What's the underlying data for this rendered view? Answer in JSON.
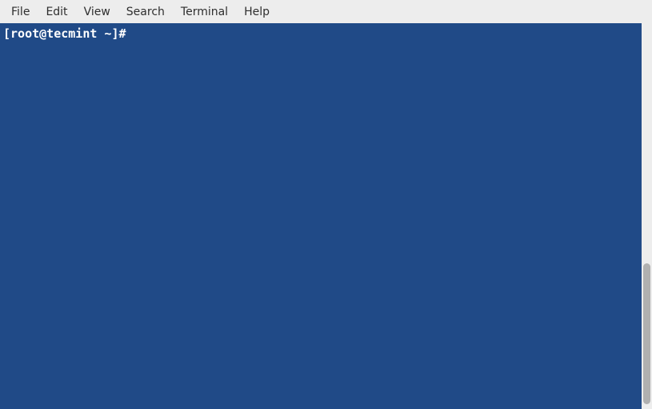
{
  "menubar": {
    "items": [
      "File",
      "Edit",
      "View",
      "Search",
      "Terminal",
      "Help"
    ]
  },
  "terminal": {
    "prompt": "[root@tecmint ~]# ",
    "background": "#204a87",
    "foreground": "#ffffff"
  }
}
